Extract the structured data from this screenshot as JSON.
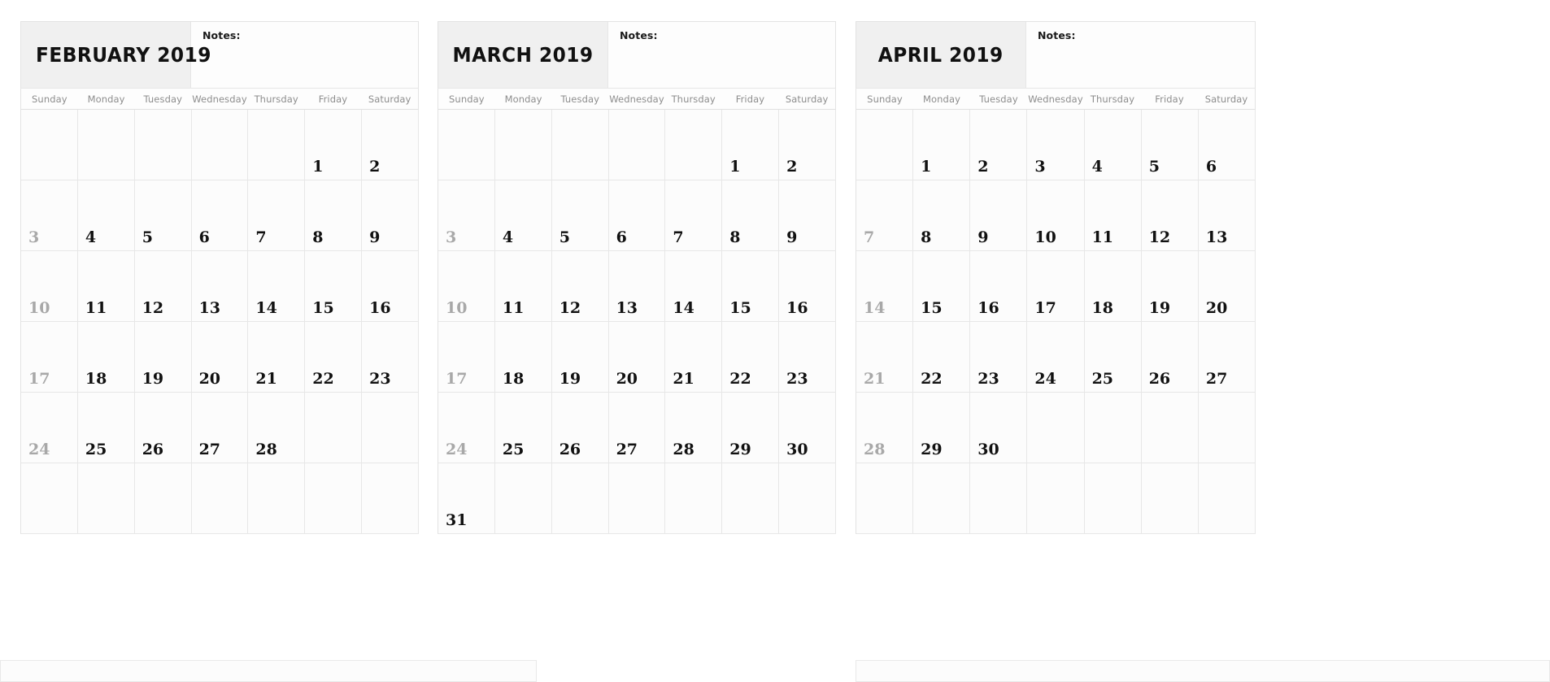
{
  "notes_label": "Notes:",
  "weekdays": [
    "Sunday",
    "Monday",
    "Tuesday",
    "Wednesday",
    "Thursday",
    "Friday",
    "Saturday"
  ],
  "colors": {
    "title_box_bg": "#f0f0f0",
    "grid_line": "#e7e7e7",
    "weekday_text": "#8d8d8d",
    "day_text": "#111111",
    "sunday_text": "#a8a8a8",
    "page_bg": "#ffffff"
  },
  "months": [
    {
      "id": "february-2019",
      "title": "FEBRUARY 2019",
      "title_align": "left",
      "weeks": [
        [
          {
            "n": "",
            "muted": false
          },
          {
            "n": "",
            "muted": false
          },
          {
            "n": "",
            "muted": false
          },
          {
            "n": "",
            "muted": false
          },
          {
            "n": "",
            "muted": false
          },
          {
            "n": "1",
            "muted": false
          },
          {
            "n": "2",
            "muted": false
          }
        ],
        [
          {
            "n": "3",
            "muted": true
          },
          {
            "n": "4",
            "muted": false
          },
          {
            "n": "5",
            "muted": false
          },
          {
            "n": "6",
            "muted": false
          },
          {
            "n": "7",
            "muted": false
          },
          {
            "n": "8",
            "muted": false
          },
          {
            "n": "9",
            "muted": false
          }
        ],
        [
          {
            "n": "10",
            "muted": true
          },
          {
            "n": "11",
            "muted": false
          },
          {
            "n": "12",
            "muted": false
          },
          {
            "n": "13",
            "muted": false
          },
          {
            "n": "14",
            "muted": false
          },
          {
            "n": "15",
            "muted": false
          },
          {
            "n": "16",
            "muted": false
          }
        ],
        [
          {
            "n": "17",
            "muted": true
          },
          {
            "n": "18",
            "muted": false
          },
          {
            "n": "19",
            "muted": false
          },
          {
            "n": "20",
            "muted": false
          },
          {
            "n": "21",
            "muted": false
          },
          {
            "n": "22",
            "muted": false
          },
          {
            "n": "23",
            "muted": false
          }
        ],
        [
          {
            "n": "24",
            "muted": true
          },
          {
            "n": "25",
            "muted": false
          },
          {
            "n": "26",
            "muted": false
          },
          {
            "n": "27",
            "muted": false
          },
          {
            "n": "28",
            "muted": false
          },
          {
            "n": "",
            "muted": false
          },
          {
            "n": "",
            "muted": false
          }
        ],
        [
          {
            "n": "",
            "muted": false
          },
          {
            "n": "",
            "muted": false
          },
          {
            "n": "",
            "muted": false
          },
          {
            "n": "",
            "muted": false
          },
          {
            "n": "",
            "muted": false
          },
          {
            "n": "",
            "muted": false
          },
          {
            "n": "",
            "muted": false
          }
        ]
      ]
    },
    {
      "id": "march-2019",
      "title": "MARCH 2019",
      "title_align": "center",
      "weeks": [
        [
          {
            "n": "",
            "muted": false
          },
          {
            "n": "",
            "muted": false
          },
          {
            "n": "",
            "muted": false
          },
          {
            "n": "",
            "muted": false
          },
          {
            "n": "",
            "muted": false
          },
          {
            "n": "1",
            "muted": false
          },
          {
            "n": "2",
            "muted": false
          }
        ],
        [
          {
            "n": "3",
            "muted": true
          },
          {
            "n": "4",
            "muted": false
          },
          {
            "n": "5",
            "muted": false
          },
          {
            "n": "6",
            "muted": false
          },
          {
            "n": "7",
            "muted": false
          },
          {
            "n": "8",
            "muted": false
          },
          {
            "n": "9",
            "muted": false
          }
        ],
        [
          {
            "n": "10",
            "muted": true
          },
          {
            "n": "11",
            "muted": false
          },
          {
            "n": "12",
            "muted": false
          },
          {
            "n": "13",
            "muted": false
          },
          {
            "n": "14",
            "muted": false
          },
          {
            "n": "15",
            "muted": false
          },
          {
            "n": "16",
            "muted": false
          }
        ],
        [
          {
            "n": "17",
            "muted": true
          },
          {
            "n": "18",
            "muted": false
          },
          {
            "n": "19",
            "muted": false
          },
          {
            "n": "20",
            "muted": false
          },
          {
            "n": "21",
            "muted": false
          },
          {
            "n": "22",
            "muted": false
          },
          {
            "n": "23",
            "muted": false
          }
        ],
        [
          {
            "n": "24",
            "muted": true
          },
          {
            "n": "25",
            "muted": false
          },
          {
            "n": "26",
            "muted": false
          },
          {
            "n": "27",
            "muted": false
          },
          {
            "n": "28",
            "muted": false
          },
          {
            "n": "29",
            "muted": false
          },
          {
            "n": "30",
            "muted": false
          }
        ],
        [
          {
            "n": "31",
            "muted": false
          },
          {
            "n": "",
            "muted": false
          },
          {
            "n": "",
            "muted": false
          },
          {
            "n": "",
            "muted": false
          },
          {
            "n": "",
            "muted": false
          },
          {
            "n": "",
            "muted": false
          },
          {
            "n": "",
            "muted": false
          }
        ]
      ]
    },
    {
      "id": "april-2019",
      "title": "APRIL 2019",
      "title_align": "center",
      "weeks": [
        [
          {
            "n": "",
            "muted": false
          },
          {
            "n": "1",
            "muted": false
          },
          {
            "n": "2",
            "muted": false
          },
          {
            "n": "3",
            "muted": false
          },
          {
            "n": "4",
            "muted": false
          },
          {
            "n": "5",
            "muted": false
          },
          {
            "n": "6",
            "muted": false
          }
        ],
        [
          {
            "n": "7",
            "muted": true
          },
          {
            "n": "8",
            "muted": false
          },
          {
            "n": "9",
            "muted": false
          },
          {
            "n": "10",
            "muted": false
          },
          {
            "n": "11",
            "muted": false
          },
          {
            "n": "12",
            "muted": false
          },
          {
            "n": "13",
            "muted": false
          }
        ],
        [
          {
            "n": "14",
            "muted": true
          },
          {
            "n": "15",
            "muted": false
          },
          {
            "n": "16",
            "muted": false
          },
          {
            "n": "17",
            "muted": false
          },
          {
            "n": "18",
            "muted": false
          },
          {
            "n": "19",
            "muted": false
          },
          {
            "n": "20",
            "muted": false
          }
        ],
        [
          {
            "n": "21",
            "muted": true
          },
          {
            "n": "22",
            "muted": false
          },
          {
            "n": "23",
            "muted": false
          },
          {
            "n": "24",
            "muted": false
          },
          {
            "n": "25",
            "muted": false
          },
          {
            "n": "26",
            "muted": false
          },
          {
            "n": "27",
            "muted": false
          }
        ],
        [
          {
            "n": "28",
            "muted": true
          },
          {
            "n": "29",
            "muted": false
          },
          {
            "n": "30",
            "muted": false
          },
          {
            "n": "",
            "muted": false
          },
          {
            "n": "",
            "muted": false
          },
          {
            "n": "",
            "muted": false
          },
          {
            "n": "",
            "muted": false
          }
        ],
        [
          {
            "n": "",
            "muted": false
          },
          {
            "n": "",
            "muted": false
          },
          {
            "n": "",
            "muted": false
          },
          {
            "n": "",
            "muted": false
          },
          {
            "n": "",
            "muted": false
          },
          {
            "n": "",
            "muted": false
          },
          {
            "n": "",
            "muted": false
          }
        ]
      ]
    }
  ]
}
